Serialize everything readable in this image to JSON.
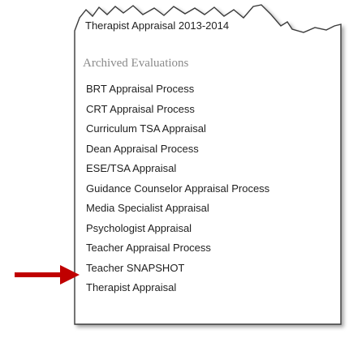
{
  "menu": {
    "top_item": "Therapist Appraisal 2013-2014",
    "section_heading": "Archived Evaluations",
    "items": [
      "BRT Appraisal Process",
      "CRT Appraisal Process",
      "Curriculum TSA Appraisal",
      "Dean Appraisal Process",
      "ESE/TSA Appraisal",
      "Guidance Counselor Appraisal Process",
      "Media Specialist Appraisal",
      "Psychologist Appraisal",
      "Teacher Appraisal Process",
      "Teacher SNAPSHOT",
      "Therapist Appraisal"
    ],
    "highlighted_item": "Teacher Appraisal Process"
  },
  "colors": {
    "arrow": "#c00000",
    "heading": "#8a8a8a",
    "text": "#1f1f1f",
    "border": "#3a3a3a"
  },
  "icons": {
    "pointer": "arrow-right-icon"
  }
}
